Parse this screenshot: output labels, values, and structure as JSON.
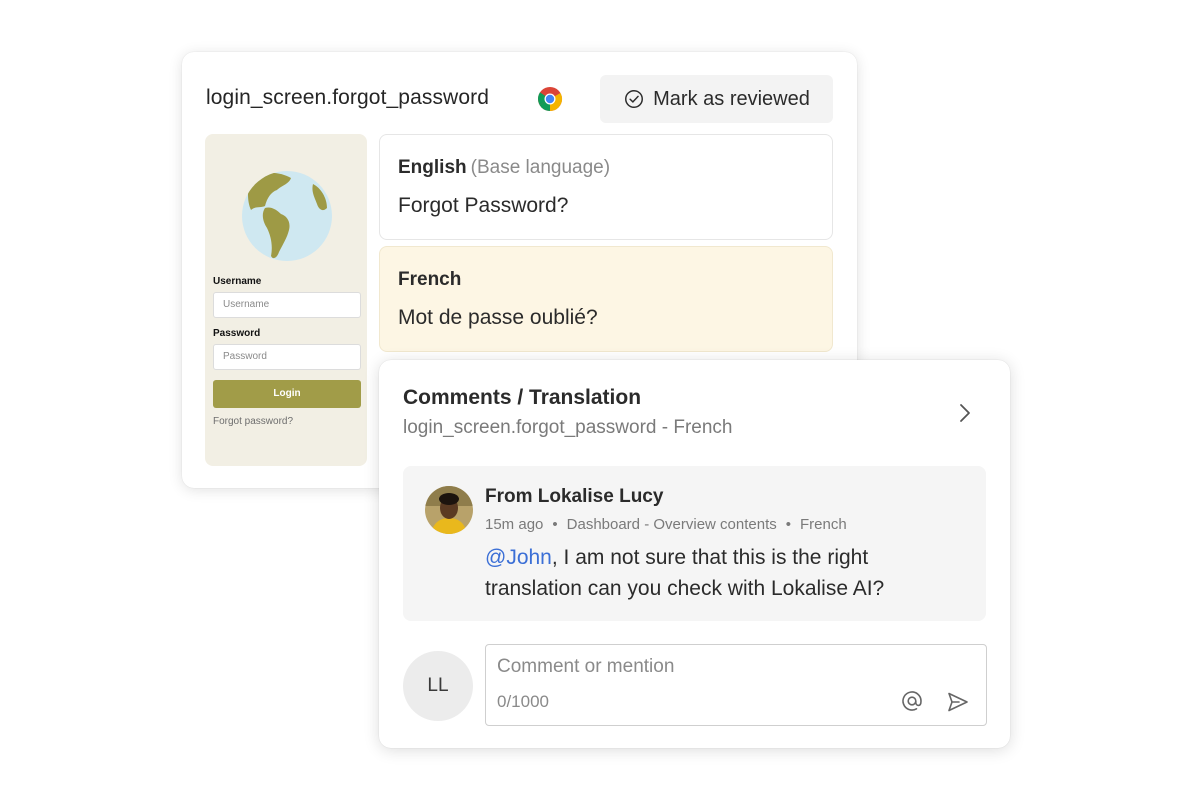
{
  "key_card": {
    "title": "login_screen.forgot_password",
    "review_button_label": "Mark as reviewed",
    "review_icon": "check-circle-icon",
    "browser_icon": "chrome-icon",
    "preview": {
      "username_label": "Username",
      "username_placeholder": "Username",
      "password_label": "Password",
      "password_placeholder": "Password",
      "login_button": "Login",
      "forgot_link": "Forgot password?"
    },
    "translations": [
      {
        "language": "English",
        "note": "(Base language)",
        "text": "Forgot Password?"
      },
      {
        "language": "French",
        "note": "",
        "text": "Mot de passe oublié?"
      }
    ]
  },
  "comments": {
    "title": "Comments / Translation",
    "subtitle": "login_screen.forgot_password - French",
    "message": {
      "from": "From Lokalise Lucy",
      "time": "15m ago",
      "location": "Dashboard - Overview contents",
      "language": "French",
      "mention": "@John",
      "body": ", I am not sure that this is the right translation can you check with Lokalise AI?"
    },
    "user_initials": "LL",
    "input_placeholder": "Comment or mention",
    "char_count": "0/1000"
  },
  "colors": {
    "preview_bg": "#f2efe4",
    "accent_olive": "#a19c48",
    "french_bg": "#fdf6e4",
    "mention_blue": "#3b6fd6"
  }
}
